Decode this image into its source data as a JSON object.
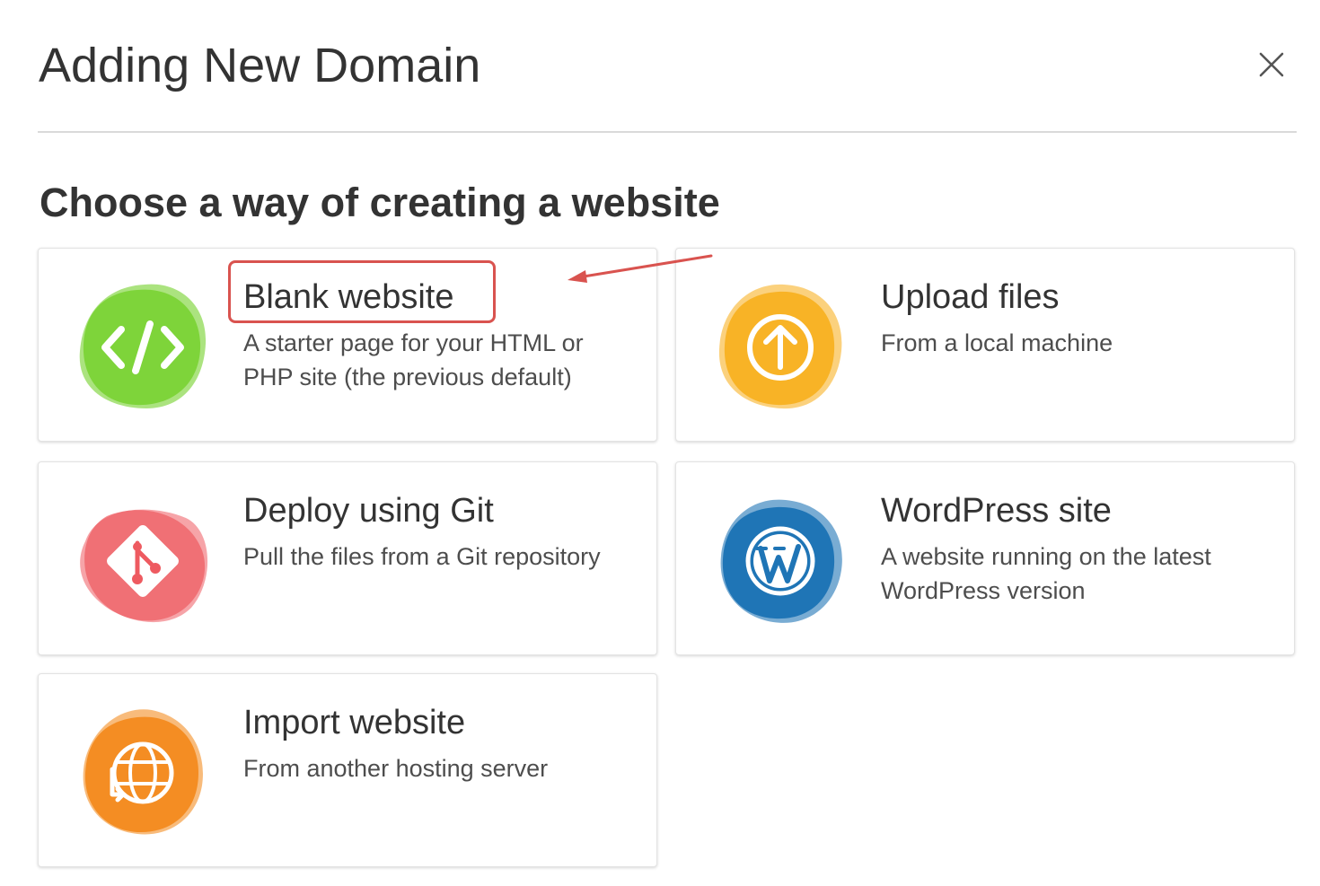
{
  "dialog": {
    "title": "Adding New Domain",
    "subtitle": "Choose a way of creating a website"
  },
  "colors": {
    "green": "#7ed43a",
    "yellow": "#f8b326",
    "red": "#ee5a60",
    "blue": "#1f75b6",
    "orange": "#f48d23",
    "annotation": "#d9534f"
  },
  "options": [
    {
      "title": "Blank website",
      "description": "A starter page for your HTML or PHP site (the previous default)",
      "icon": "code-icon",
      "color": "green"
    },
    {
      "title": "Upload files",
      "description": "From a local machine",
      "icon": "upload-icon",
      "color": "yellow"
    },
    {
      "title": "Deploy using Git",
      "description": "Pull the files from a Git repository",
      "icon": "git-icon",
      "color": "red"
    },
    {
      "title": "WordPress site",
      "description": "A website running on the latest WordPress version",
      "icon": "wordpress-icon",
      "color": "blue"
    },
    {
      "title": "Import website",
      "description": "From another hosting server",
      "icon": "globe-import-icon",
      "color": "orange"
    }
  ]
}
